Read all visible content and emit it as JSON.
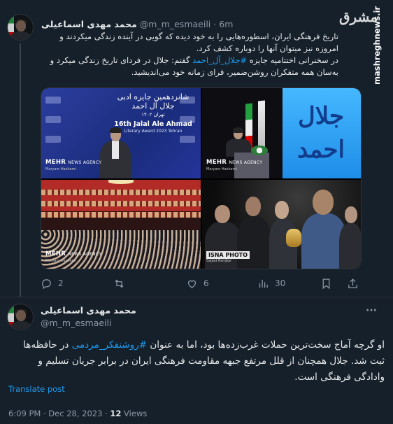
{
  "tweet1": {
    "name": "محمد مهدی اسماعیلی",
    "handle": "@m_m_esmaeili",
    "dot": "·",
    "time": "6m",
    "text_p1": "تاریخ فرهنگی ایران، اسطوره‌هایی را به خود دیده که گویی در آینده زندگی میکردند و امروزه نیز میتوان آنها را دوباره کشف کرد.",
    "text_p2_before": "در سخنرانی اختتامیه جایزه ",
    "text_hashtag": "#جلال_آل_احمد",
    "text_p2_after": " گفتم: جلال در فردای تاریخ زندگی میکرد و به‌سان همه متفکران روشن‌ضمیر، فرای زمانه خود می‌اندیشید.",
    "photos": {
      "banner_title_line1": "شانزدهمین جایزه ادبی",
      "banner_title_line2": "جلال آل احمد",
      "banner_title_line3": "تهران ۱۴۰۲",
      "banner_en": "16th Jalal Ale Ahmad",
      "banner_en_sub": "Literary Award 2023 Tehran",
      "calligraphy": "جلال احمد",
      "wm_mehr": "MEHR",
      "wm_mehr_sub": "NEWS AGENCY",
      "wm_credit1": "Maryam Hashemi",
      "wm_isna": "ISNA PHOTO",
      "wm_credit2": "Sajjad Ranjbar"
    },
    "actions": {
      "replies": "2",
      "retweets": "",
      "likes": "6",
      "views": "30"
    }
  },
  "watermark": {
    "logo": "مشرق",
    "side": "mashreghnews.ir"
  },
  "tweet2": {
    "name": "محمد مهدی اسماعیلی",
    "handle": "@m_m_esmaeili",
    "more": "···",
    "text_before": "او گرچه آماج سخت‌ترین حملات غرب‌زده‌ها بود، اما به عنوان ",
    "text_hashtag": "#روشنفکر_مردمی",
    "text_after": " در حافظه‌ها ثبت شد. جلال همچنان از قلل مرتفع جبهه مقاومت فرهنگی ایران در برابر جریان تسلیم و وادادگی فرهنگی است.",
    "translate": "Translate post",
    "meta_time": "6:09 PM · Dec 28, 2023 · ",
    "meta_views_count": "12",
    "meta_views_label": " Views"
  },
  "colors": {
    "background": "#15202b",
    "text": "#e7e9ea",
    "muted": "#8b98a5",
    "accent": "#1d9bf0"
  }
}
